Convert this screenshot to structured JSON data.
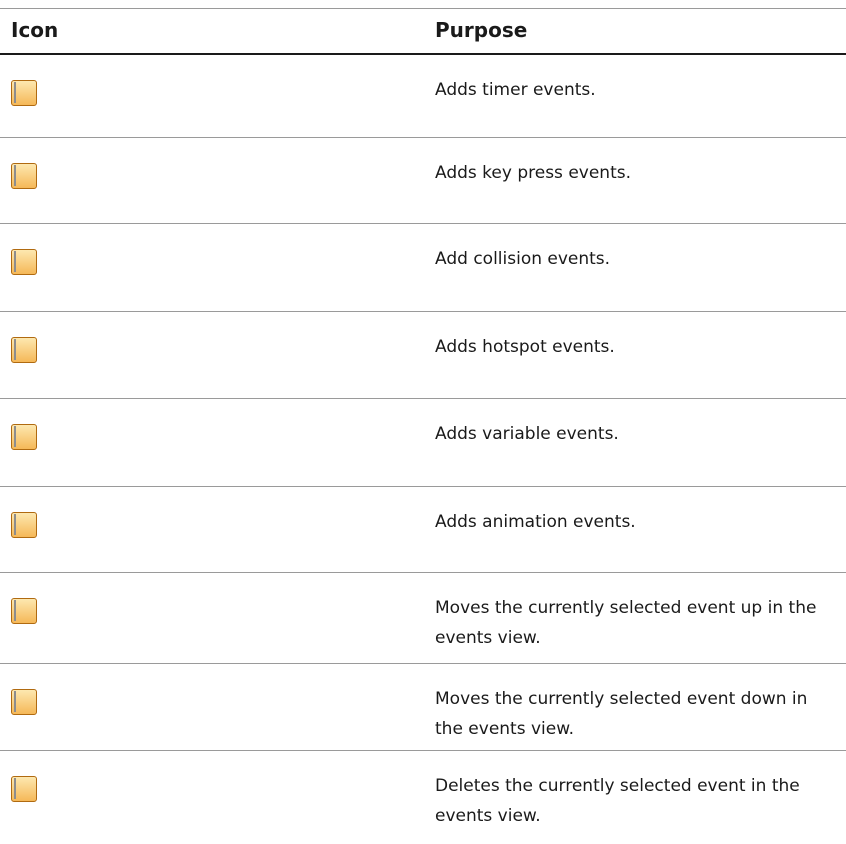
{
  "header": {
    "icon_label": "Icon",
    "purpose_label": "Purpose"
  },
  "rows": [
    {
      "icon": "timer-icon",
      "purpose": "Adds timer events."
    },
    {
      "icon": "key-press-icon",
      "purpose": "Adds key press events."
    },
    {
      "icon": "collision-icon",
      "purpose": "Add collision events."
    },
    {
      "icon": "hotspot-icon",
      "purpose": "Adds hotspot events."
    },
    {
      "icon": "variable-icon",
      "purpose": "Adds variable events."
    },
    {
      "icon": "animation-icon",
      "purpose": "Adds animation events."
    },
    {
      "icon": "move-up-icon",
      "purpose": "Moves the currently selected event up in the events view."
    },
    {
      "icon": "move-down-icon",
      "purpose": "Moves the currently selected event down in the events view."
    },
    {
      "icon": "delete-icon",
      "purpose": "Deletes the currently selected event in the events view."
    }
  ],
  "colors": {
    "icon_frame": "#f5b858",
    "rule": "#9a9a9a",
    "header_rule": "#1a1a1a"
  }
}
